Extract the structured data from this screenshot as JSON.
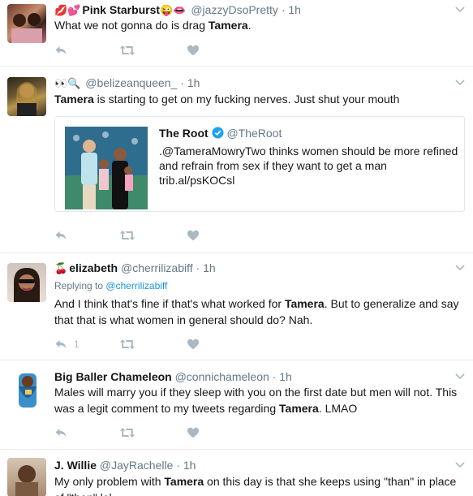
{
  "tweets": [
    {
      "emoji": "💋💕",
      "name": "Pink Starburst",
      "name_emoji": "😜👄",
      "handle": "@jazzyDsoPretty",
      "time": "1h",
      "text_parts": [
        "What we not gonna do is drag ",
        "Tamera",
        "."
      ]
    },
    {
      "emoji": "👀🔍",
      "handle": "@belizeanqueen_",
      "time": "1h",
      "text_parts": [
        "Tamera",
        " is starting to get on my fucking nerves. Just shut your mouth"
      ],
      "quote": {
        "name": "The Root",
        "handle": "@TheRoot",
        "text": ".@TameraMowryTwo thinks women should be more refined and refrain from sex if they want to get a man trib.al/psKOCsl"
      }
    },
    {
      "emoji": "🍒",
      "name": "elizabeth",
      "handle": "@cherrilizabiff",
      "time": "1h",
      "replying_label": "Replying to",
      "replying_handle": "@cherrilizabiff",
      "text_parts": [
        "And I think that's fine if that's what worked for ",
        "Tamera",
        ". But to generalize and say that that is what women in general should do? Nah."
      ],
      "reply_count": "1"
    },
    {
      "name": "Big Baller Chameleon",
      "handle": "@connichameleon",
      "time": "1h",
      "text_parts": [
        "Males will marry you if they sleep with you on the first date but men will not. This was a legit comment to my tweets regarding ",
        "Tamera",
        ". LMAO"
      ]
    },
    {
      "name": "J. Willie",
      "handle": "@JayRachelle",
      "time": "1h",
      "text_parts": [
        "My only problem with ",
        "Tamera",
        " on this day is that she keeps using \"than\" in place of \"then\" lol"
      ]
    }
  ],
  "separator": "·",
  "colors": {
    "secondary": "#657786",
    "link": "#1b95e0",
    "icon": "#aab8c2",
    "verified": "#1da1f2"
  },
  "icons": [
    "reply-icon",
    "retweet-icon",
    "like-icon",
    "chevron-down-icon",
    "verified-icon"
  ]
}
